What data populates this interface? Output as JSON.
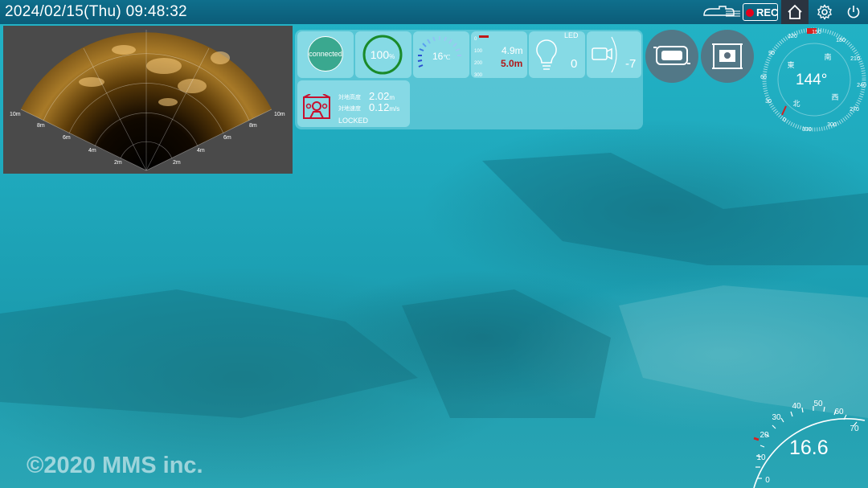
{
  "header": {
    "datetime": "2024/02/15(Thu) 09:48:32",
    "rec_label": "REC",
    "icons": [
      "rov-icon",
      "record-dot-icon",
      "home-icon",
      "gear-icon",
      "power-icon"
    ]
  },
  "sonar": {
    "range_labels": [
      "2m",
      "4m",
      "6m",
      "8m",
      "10m"
    ]
  },
  "status": {
    "connection": "connected",
    "battery": "100",
    "battery_unit": "%",
    "temperature": "16",
    "temperature_unit": "℃",
    "depth_scale": [
      "0",
      "100",
      "200",
      "300"
    ],
    "depth_current": "4.9m",
    "depth_limit": "5.0m",
    "led_label": "LED",
    "led_value": "0",
    "camera_tilt": "-7",
    "altitude_label": "対地高度",
    "altitude_value": "2.02",
    "altitude_unit": "m",
    "ground_speed_label": "対地速度",
    "ground_speed_value": "0.12",
    "ground_speed_unit": "m/s",
    "lock_status": "LOCKED"
  },
  "compass": {
    "heading": "144°",
    "ticks": [
      "120",
      "150",
      "180",
      "210",
      "240",
      "270",
      "300",
      "330",
      "0",
      "30",
      "60",
      "90"
    ],
    "cardinals": {
      "east": "東",
      "south": "南",
      "west": "西",
      "north": "北"
    }
  },
  "speedometer": {
    "value": "16.6",
    "ticks": [
      "0",
      "10",
      "20",
      "30",
      "40",
      "50",
      "60",
      "70"
    ]
  },
  "watermark": "©2020 MMS inc."
}
